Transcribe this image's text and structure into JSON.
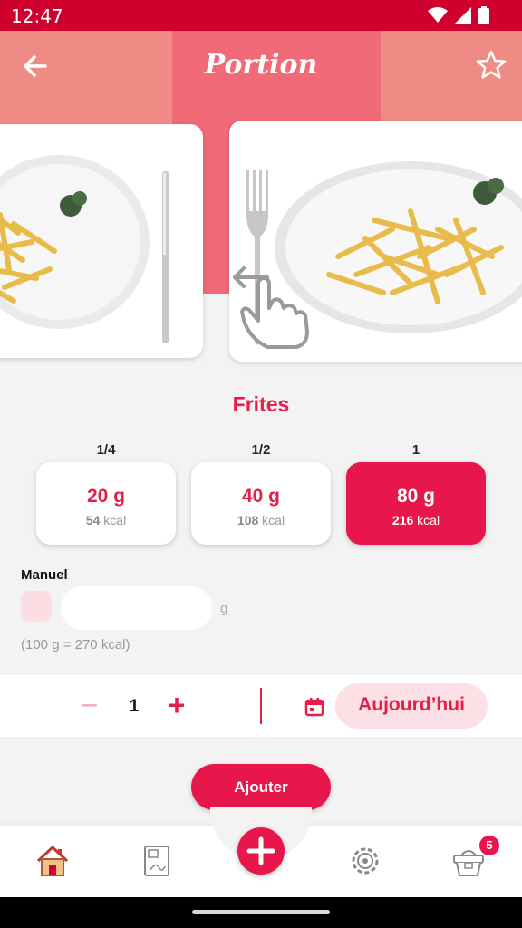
{
  "status_bar": {
    "time": "12:47"
  },
  "header": {
    "title": "Portion",
    "back_icon": "back-arrow-icon",
    "favorite_icon": "star-icon"
  },
  "carousel": {
    "hint_icon": "swipe-hand-icon"
  },
  "food": {
    "name": "Frites"
  },
  "portions": [
    {
      "fraction": "1/4",
      "grams": "20 g",
      "kcal_value": "54",
      "kcal_unit": "kcal",
      "selected": false
    },
    {
      "fraction": "1/2",
      "grams": "40 g",
      "kcal_value": "108",
      "kcal_unit": "kcal",
      "selected": false
    },
    {
      "fraction": "1",
      "grams": "80 g",
      "kcal_value": "216",
      "kcal_unit": "kcal",
      "selected": true
    }
  ],
  "manual": {
    "label": "Manuel",
    "value": "",
    "unit": "g",
    "hint": "(100 g = 270 kcal)"
  },
  "quantity": {
    "minus": "−",
    "value": "1",
    "plus": "+"
  },
  "date": {
    "label": "Aujourd’hui",
    "icon": "calendar-icon"
  },
  "actions": {
    "add_label": "Ajouter"
  },
  "nav": {
    "items": [
      "home-icon",
      "journal-icon",
      "add-icon",
      "settings-icon",
      "basket-icon"
    ],
    "basket_badge": "5"
  },
  "colors": {
    "primary": "#e8174b",
    "status_bar": "#d0002e",
    "header": "#f08a84"
  }
}
